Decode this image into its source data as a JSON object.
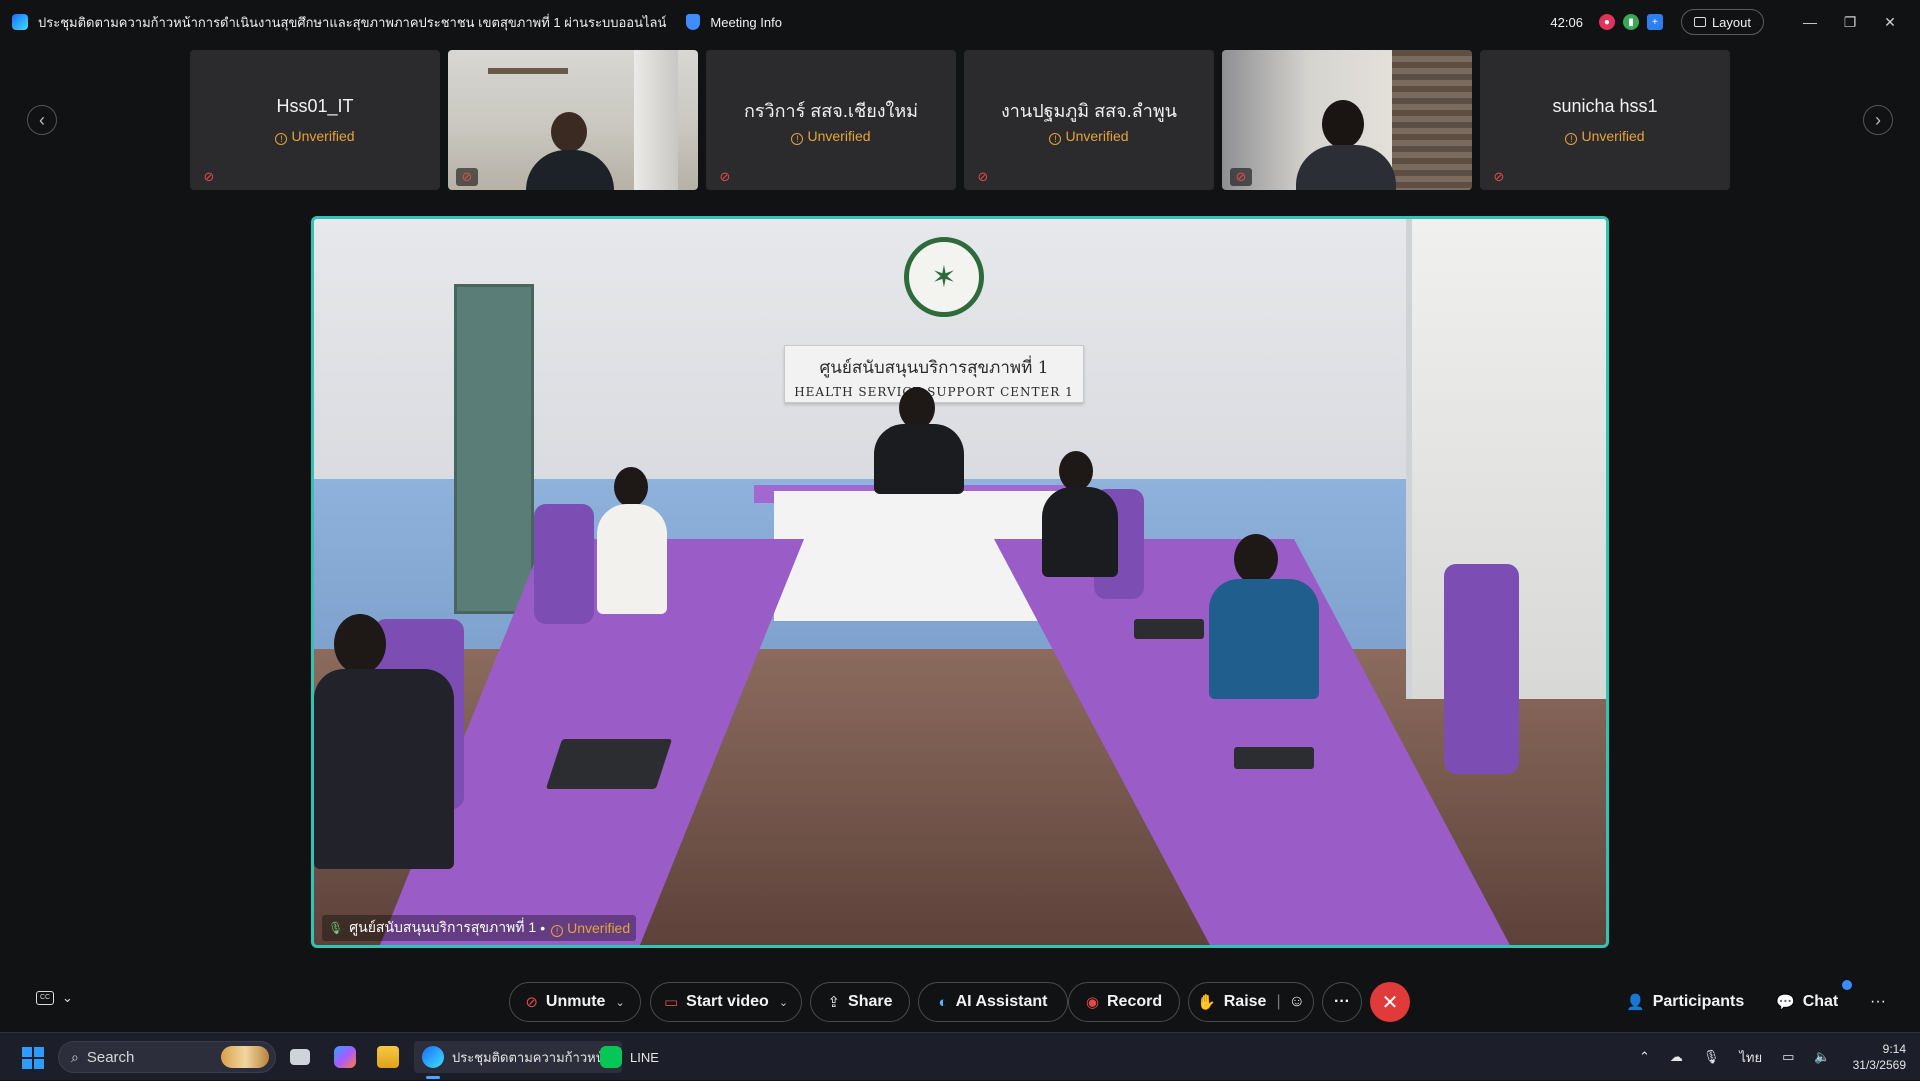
{
  "window": {
    "title": "ประชุมติดตามความก้าวหน้าการดำเนินงานสุขศึกษาและสุขภาพภาคประชาชน เขตสุขภาพที่ 1 ผ่านระบบออนไลน์",
    "meeting_info": "Meeting Info",
    "timer": "42:06",
    "layout_label": "Layout"
  },
  "thumbnails": [
    {
      "name": "Hss01_IT",
      "status": "Unverified",
      "video": false
    },
    {
      "name": "",
      "status": "",
      "video": true
    },
    {
      "name": "กรวิการ์ สสจ.เชียงใหม่",
      "status": "Unverified",
      "video": false
    },
    {
      "name": "งานปฐมภูมิ สสจ.ลำพูน",
      "status": "Unverified",
      "video": false
    },
    {
      "name": "",
      "status": "",
      "video": true
    },
    {
      "name": "sunicha hss1",
      "status": "Unverified",
      "video": false
    }
  ],
  "main_video": {
    "sign_th": "ศูนย์สนับสนุนบริการสุขภาพที่ 1",
    "sign_en": "HEALTH SERVICE SUPPORT CENTER 1",
    "speaker_name": "ศูนย์สนับสนุนบริการสุขภาพที่ 1",
    "speaker_status": "Unverified"
  },
  "controls": {
    "unmute": "Unmute",
    "start_video": "Start video",
    "share": "Share",
    "ai_assistant": "AI Assistant",
    "record": "Record",
    "raise": "Raise",
    "more": "···",
    "participants": "Participants",
    "chat": "Chat",
    "overflow": "···"
  },
  "taskbar": {
    "search_placeholder": "Search",
    "active_app_label": "ประชุมติดตามความก้าวหน้า",
    "line_label": "LINE",
    "language": "ไทย",
    "time": "9:14",
    "date": "31/3/2569"
  },
  "colors": {
    "accent_border": "#2ec4b6",
    "leave": "#e03a3a",
    "unverified": "#e6a33a"
  }
}
